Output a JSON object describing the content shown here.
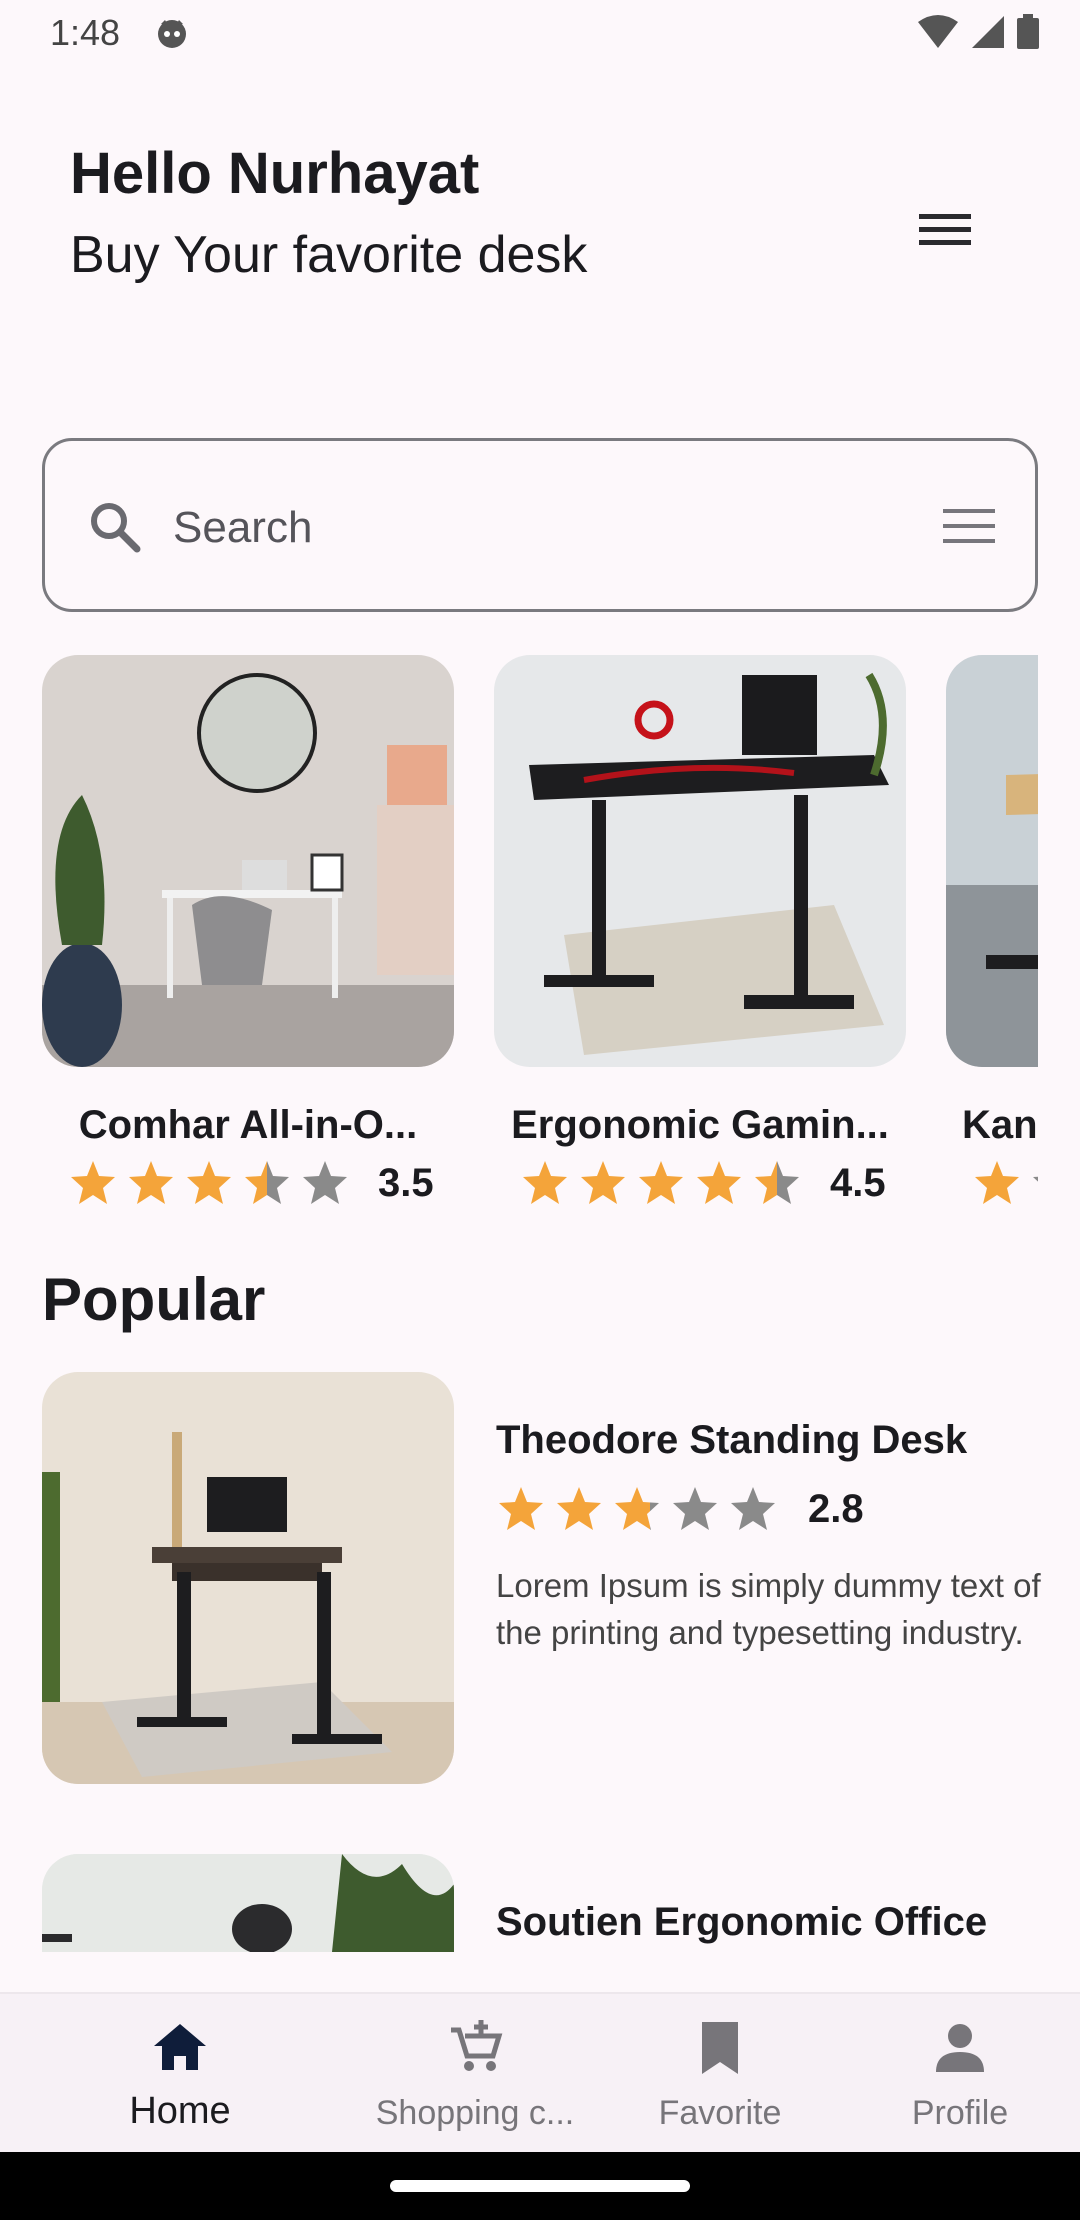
{
  "status_bar": {
    "time": "1:48"
  },
  "header": {
    "greeting": "Hello Nurhayat",
    "subtitle": "Buy Your favorite desk"
  },
  "search": {
    "placeholder": "Search"
  },
  "featured": [
    {
      "title": "Comhar All-in-O...",
      "rating": "3.5",
      "rating_value": 3.5
    },
    {
      "title": "Ergonomic Gamin...",
      "rating": "4.5",
      "rating_value": 4.5
    },
    {
      "title": "Kan",
      "rating": "",
      "rating_value": 1
    }
  ],
  "popular": {
    "title": "Popular",
    "items": [
      {
        "title": "Theodore Standing Desk",
        "rating": "2.8",
        "rating_value": 2.8,
        "description": "Lorem Ipsum is simply dummy text of the printing and typesetting industry."
      },
      {
        "title": "Soutien Ergonomic Office",
        "rating": "",
        "rating_value": 0,
        "description": ""
      }
    ]
  },
  "nav": {
    "items": [
      {
        "label": "Home",
        "icon": "home-icon",
        "active": true
      },
      {
        "label": "Shopping c...",
        "icon": "cart-add-icon",
        "active": false
      },
      {
        "label": "Favorite",
        "icon": "bookmark-icon",
        "active": false
      },
      {
        "label": "Profile",
        "icon": "person-icon",
        "active": false
      }
    ]
  },
  "colors": {
    "background": "#fdf8fb",
    "star_filled": "#f4a43a",
    "star_empty": "#8a8a8a",
    "nav_background": "#f7f1f6",
    "active_icon": "#0f1d3a"
  }
}
